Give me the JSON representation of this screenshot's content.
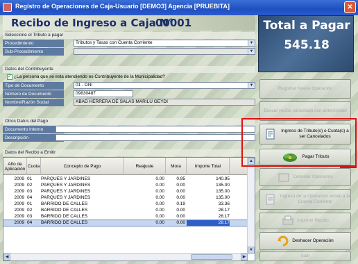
{
  "window": {
    "title": "Registro de Operaciones de Caja-Usuario [DEMO3] Agencia [PRUEBITA]",
    "close": "✕"
  },
  "header": {
    "title": "Recibo de Ingreso a Caja N°",
    "number": "00001"
  },
  "tributo": {
    "section": "Seleccione el Tributo a pagar",
    "procedimiento_label": "Procedimiento",
    "procedimiento_value": "Tributos y Tasas con Cuenta Corriente",
    "subprocedimiento_label": "Sub-Procedimiento",
    "subprocedimiento_value": ""
  },
  "contribuyente": {
    "section": "Datos del Contribuyente",
    "check_label": "¿La persona que se esta atendiendo es Contribuyente de la Municipalidad?",
    "checked": true,
    "tipo_doc_label": "Tipo de Documento",
    "tipo_doc_value": "01 - DNI",
    "num_doc_label": "Número de Documento",
    "num_doc_value": "09830487",
    "nombre_label": "Nombre/Razón Social",
    "nombre_value": "ABAD HERRERA DE SALAS MARILU GEYDI"
  },
  "otros": {
    "section": "Otros Datos del Pago",
    "doc_interno_label": "Documento Interno",
    "doc_interno_value": "",
    "descripcion_label": "Descripción",
    "descripcion_value": ""
  },
  "recibo": {
    "section": "Datos del Recibo a Emitir",
    "columns": [
      "Año de Aplicación",
      "Cuota",
      "Concepto de Pago",
      "Reajuste",
      "Mora",
      "Importe Total"
    ],
    "rows": [
      [
        "2009",
        "01",
        "PARQUES Y JARDINES",
        "0.00",
        "0.95",
        "140.95"
      ],
      [
        "2009",
        "02",
        "PARQUES Y JARDINES",
        "0.00",
        "0.00",
        "135.00"
      ],
      [
        "2009",
        "03",
        "PARQUES Y JARDINES",
        "0.00",
        "0.00",
        "135.00"
      ],
      [
        "2009",
        "04",
        "PARQUES Y JARDINES",
        "0.00",
        "0.00",
        "135.00"
      ],
      [
        "2009",
        "01",
        "BARRIDO DE CALLES",
        "0.00",
        "0.19",
        "33.36"
      ],
      [
        "2009",
        "02",
        "BARRIDO DE CALLES",
        "0.00",
        "0.00",
        "28.17"
      ],
      [
        "2009",
        "03",
        "BARRIDO DE CALLES",
        "0.00",
        "0.00",
        "28.17"
      ],
      [
        "2009",
        "04",
        "BARRIDO DE CALLES",
        "0.00",
        "0.00",
        "28.17"
      ]
    ],
    "selected_row": 7
  },
  "total": {
    "label": "Total a Pagar",
    "amount": "545.18"
  },
  "actions": {
    "registrar": "Registrar Nueva Operación",
    "buscar": "Buscar recibo cancelado con anterioridad",
    "ingreso_tributo": "Ingreso de Tributo(s) o Cuota(s) a ser Cancelados",
    "pagar": "Pagar Tributo",
    "cancelar": "Cancelar Operación",
    "ingreso_operacion": "Ingreso de la Operación actual a la Cuenta Corriente",
    "imprimir": "Imprimir Recibo",
    "deshacer": "Deshacer Operación",
    "salir": "Salir"
  },
  "icons": {
    "app": "app-icon",
    "close": "close-icon",
    "dropdown": "chevron-down-icon",
    "pay": "money-icon",
    "cancel": "cancel-icon",
    "undo": "undo-arrow-icon"
  },
  "colors": {
    "title_bar": "#1f4fbf",
    "label_bg": "#5e7aa0",
    "total_bg": "#3c5f88",
    "highlight": "#e01010",
    "selection": "#2e5fc4"
  }
}
